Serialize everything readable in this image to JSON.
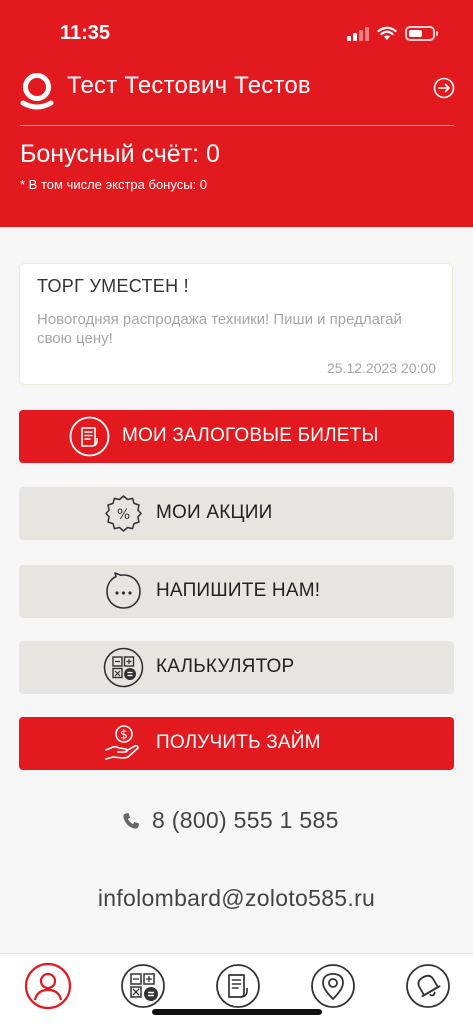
{
  "status_bar": {
    "time": "11:35",
    "icons": [
      "signal-icon",
      "wifi-icon",
      "battery-icon"
    ]
  },
  "header": {
    "user_name": "Тест Тестович Тестов",
    "bonus_label": "Бонусный счёт: 0",
    "bonus_note": "* В том числе экстра бонусы: 0",
    "accent_color": "#e21a1f"
  },
  "news": {
    "title": "ТОРГ УМЕСТЕН !",
    "text": "Новогодняя распродажа техники! Пиши и предлагай свою цену!",
    "date": "25.12.2023 20:00"
  },
  "menu": {
    "tickets": "МОИ ЗАЛОГОВЫЕ БИЛЕТЫ",
    "promotions": "МОИ АКЦИИ",
    "write_us": "НАПИШИТЕ НАМ!",
    "calculator": "КАЛЬКУЛЯТОР",
    "loan": "ПОЛУЧИТЬ ЗАЙМ"
  },
  "contacts": {
    "phone": "8 (800) 555 1 585",
    "email": "infolombard@zoloto585.ru"
  },
  "tabbar": {
    "icons": [
      "profile-icon",
      "calculator-icon",
      "document-icon",
      "location-icon",
      "bell-icon"
    ]
  }
}
